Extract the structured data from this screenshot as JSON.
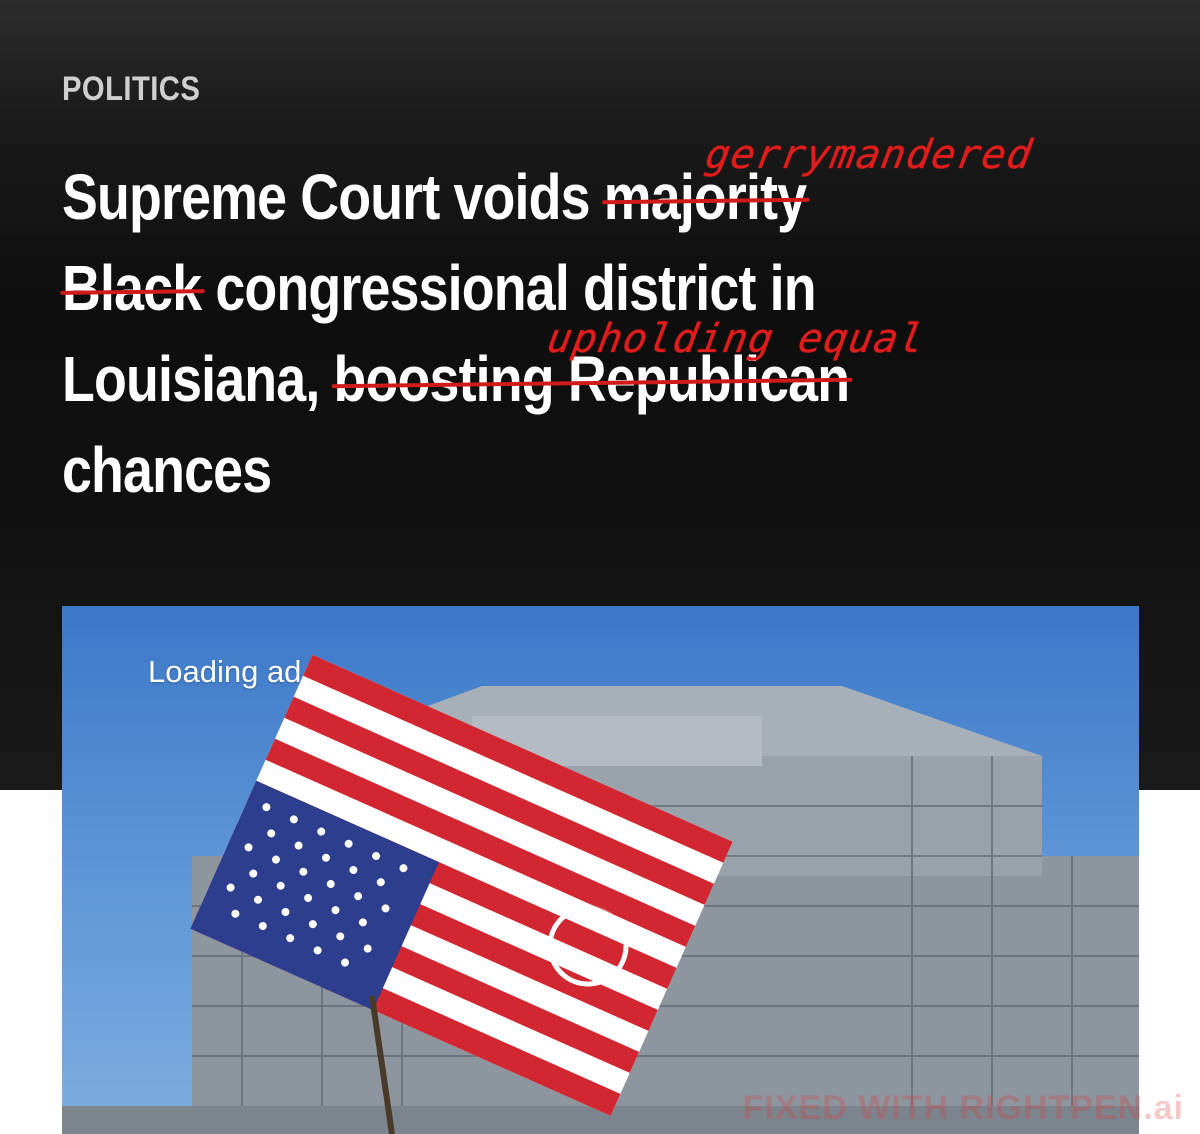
{
  "article": {
    "kicker": "POLITICS",
    "headline": {
      "line1_a": "Supreme Court voids ",
      "line1_struck": "majority",
      "line2_struck": "Black",
      "line2_b": " congressional district in",
      "line3_a": "Louisiana, ",
      "line3_struck": "boosting Republican",
      "line4": "chances"
    },
    "annotations": {
      "replacement_1": "gerrymandered",
      "replacement_2": "upholding equal"
    }
  },
  "media": {
    "loading_label": "Loading ad",
    "spinner_icon": "loading-spinner-icon"
  },
  "watermark": "FIXED WITH RIGHTPEN.ai",
  "colors": {
    "header_bg": "#111111",
    "annotation_red": "#e01c1c",
    "sky": "#5b93d6"
  }
}
